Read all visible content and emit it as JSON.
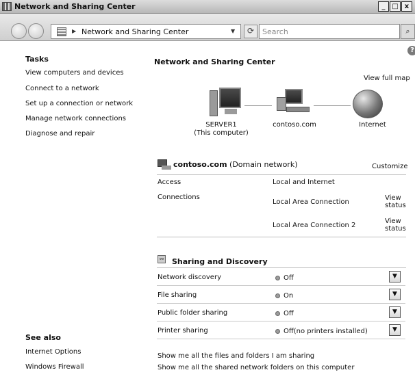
{
  "window": {
    "title": "Network and Sharing Center",
    "controls": [
      "_",
      "□",
      "x"
    ]
  },
  "address": {
    "breadcrumb": "Network and Sharing Center",
    "search_placeholder": "Search"
  },
  "tasks": {
    "heading": "Tasks",
    "items": [
      "View computers and devices",
      "Connect to a network",
      "Set up a connection or network",
      "Manage network connections",
      "Diagnose and repair"
    ]
  },
  "see_also": {
    "heading": "See also",
    "items": [
      "Internet Options",
      "Windows Firewall"
    ]
  },
  "main": {
    "title": "Network and Sharing Center",
    "view_full_map": "View full map",
    "map": {
      "computer_name": "SERVER1",
      "computer_sub": "(This computer)",
      "domain": "contoso.com",
      "internet": "Internet"
    },
    "network": {
      "name": "contoso.com",
      "type": "(Domain network)",
      "customize": "Customize",
      "access_label": "Access",
      "access_value": "Local and Internet",
      "connections_label": "Connections",
      "connections": [
        {
          "name": "Local Area Connection",
          "action_line1": "View",
          "action_line2": "status"
        },
        {
          "name": "Local Area Connection 2",
          "action_line1": "View",
          "action_line2": "status"
        }
      ]
    },
    "sharing": {
      "heading": "Sharing and Discovery",
      "items": [
        {
          "label": "Network discovery",
          "status": "Off"
        },
        {
          "label": "File sharing",
          "status": "On"
        },
        {
          "label": "Public folder sharing",
          "status": "Off"
        },
        {
          "label": "Printer sharing",
          "status": "Off(no printers installed)"
        }
      ]
    },
    "links": [
      "Show me all the files and folders I am sharing",
      "Show me all the shared network folders on this computer"
    ]
  },
  "colors": {
    "titlebar": "#c8c8c8",
    "background": "#ffffff",
    "separator": "#bcbcbc"
  }
}
